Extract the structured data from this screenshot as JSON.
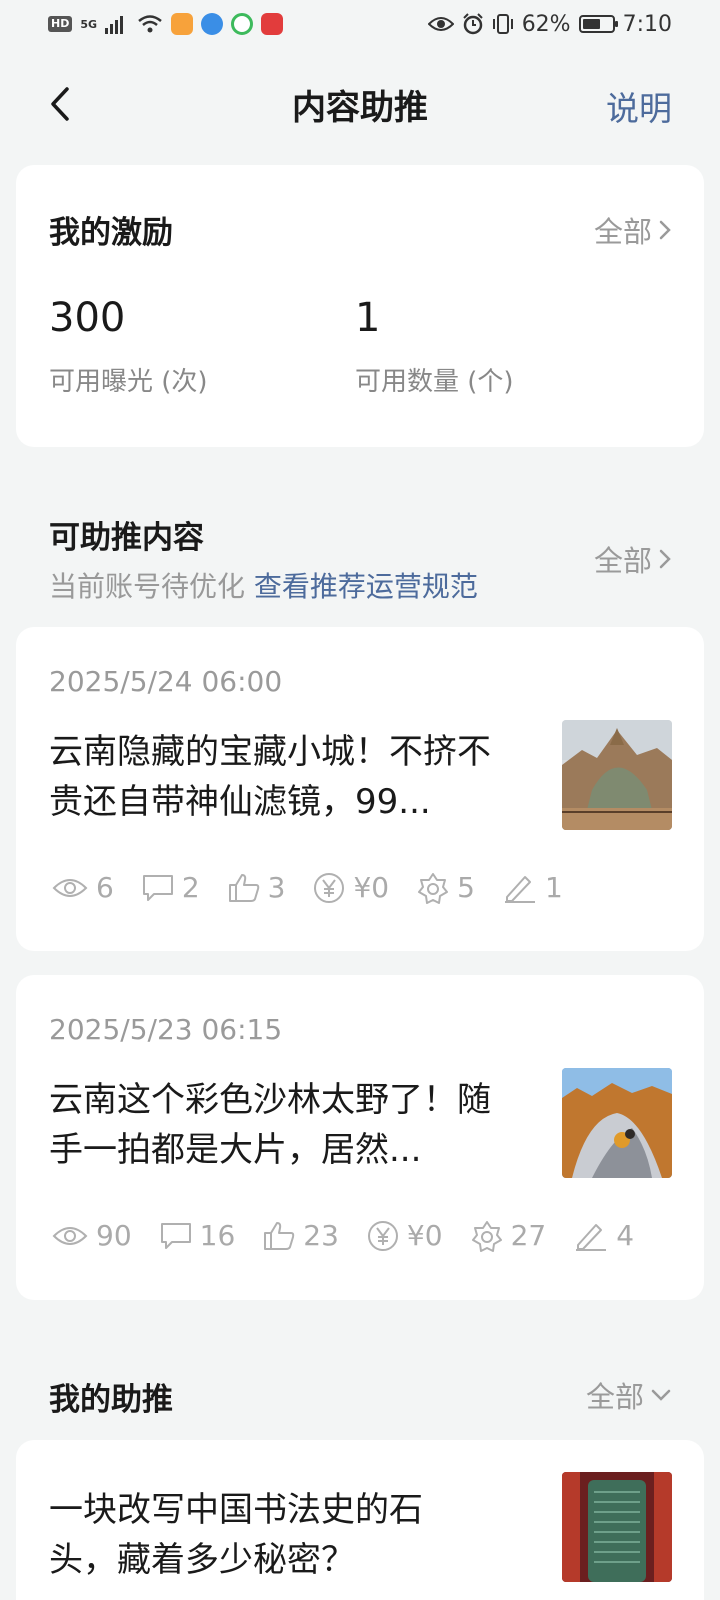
{
  "status_bar": {
    "hd": "HD",
    "net": "5G",
    "battery": "62%",
    "battery_level": 0.62,
    "time": "7:10"
  },
  "header": {
    "title": "内容助推",
    "help": "说明"
  },
  "incentive": {
    "title": "我的激励",
    "all": "全部",
    "exposure_value": "300",
    "exposure_label": "可用曝光 (次)",
    "count_value": "1",
    "count_label": "可用数量 (个)"
  },
  "promotable": {
    "title": "可助推内容",
    "subtitle": "当前账号待优化",
    "rules_link": "查看推荐运营规范",
    "all": "全部",
    "posts": [
      {
        "date": "2025/5/24 06:00",
        "title": "云南隐藏的宝藏小城！不挤不贵还自带神仙滤镜，99...",
        "views": "6",
        "comments": "2",
        "likes": "3",
        "income": "¥0",
        "favorites": "5",
        "edits": "1"
      },
      {
        "date": "2025/5/23 06:15",
        "title": "云南这个彩色沙林太野了！随手一拍都是大片，居然...",
        "views": "90",
        "comments": "16",
        "likes": "23",
        "income": "¥0",
        "favorites": "27",
        "edits": "4"
      }
    ]
  },
  "my_boost": {
    "title": "我的助推",
    "all": "全部",
    "item_title": "一块改写中国书法史的石头，藏着多少秘密？"
  },
  "colors": {
    "accent": "#4d6b9c",
    "background": "#f3f5f5",
    "muted": "#9a9a9a"
  }
}
